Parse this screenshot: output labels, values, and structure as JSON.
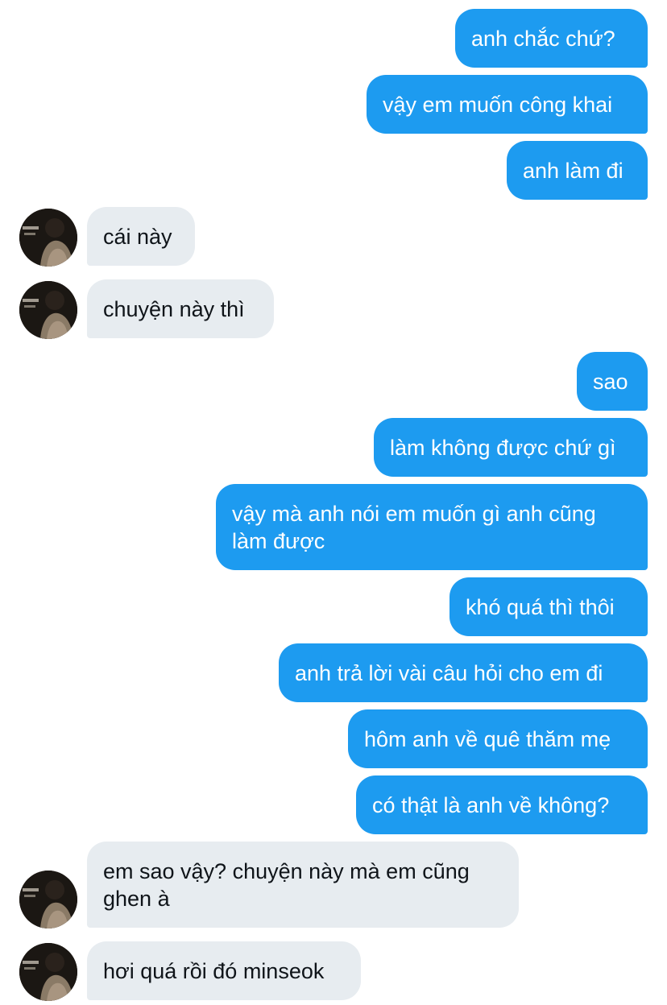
{
  "messages": [
    {
      "id": "m1",
      "side": "out",
      "text": "anh chắc chứ?"
    },
    {
      "id": "m2",
      "side": "out",
      "text": "vậy em muốn công khai"
    },
    {
      "id": "m3",
      "side": "out",
      "text": "anh làm đi"
    },
    {
      "id": "m4",
      "side": "in",
      "text": "cái này"
    },
    {
      "id": "m5",
      "side": "in",
      "text": "chuyện này thì"
    },
    {
      "id": "m6",
      "side": "out",
      "text": "sao"
    },
    {
      "id": "m7",
      "side": "out",
      "text": "làm không được chứ gì"
    },
    {
      "id": "m8",
      "side": "out",
      "text": "vậy mà anh nói em muốn gì anh cũng làm được"
    },
    {
      "id": "m9",
      "side": "out",
      "text": "khó quá thì thôi"
    },
    {
      "id": "m10",
      "side": "out",
      "text": "anh trả lời vài câu hỏi cho em đi"
    },
    {
      "id": "m11",
      "side": "out",
      "text": "hôm anh về quê thăm mẹ"
    },
    {
      "id": "m12",
      "side": "out",
      "text": "có thật là anh về không?"
    },
    {
      "id": "m13",
      "side": "in",
      "text": "em sao vậy? chuyện này mà em cũng ghen à"
    },
    {
      "id": "m14",
      "side": "in",
      "text": "hơi quá rồi đó minseok"
    }
  ],
  "colors": {
    "outgoing_bubble": "#1d9bf0",
    "incoming_bubble": "#e7ecf0",
    "outgoing_text": "#ffffff",
    "incoming_text": "#0f1419"
  },
  "icons": {
    "contact_avatar": "avatar-photo"
  }
}
